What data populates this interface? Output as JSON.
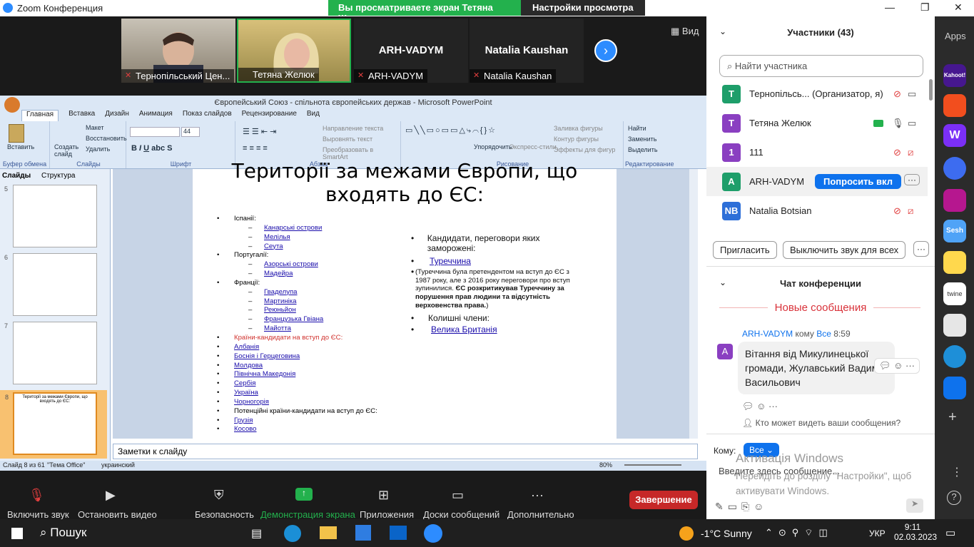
{
  "window": {
    "title": "Zoom Конференция"
  },
  "share_banner": {
    "text": "Вы просматриваете экран Тетяна Желюк",
    "settings": "Настройки просмотра"
  },
  "view_button": "Вид",
  "videos": [
    {
      "name": "Тернопільський Цен..."
    },
    {
      "name": "Тетяна Желюк"
    },
    {
      "name": "ARH-VADYM",
      "label": "ARH-VADYM"
    },
    {
      "name": "Natalia Kaushan",
      "label": "Natalia Kaushan"
    }
  ],
  "ppt": {
    "title": "Європейський Союз - спільнота європейських держав - Microsoft PowerPoint",
    "tabs": [
      "Главная",
      "Вставка",
      "Дизайн",
      "Анимация",
      "Показ слайдов",
      "Рецензирование",
      "Вид"
    ],
    "groups": {
      "clipboard": "Буфер обмена",
      "paste": "Вставить",
      "slides": "Слайды",
      "create_slide": "Создать слайд",
      "layout": "Макет",
      "reset": "Восстановить",
      "delete": "Удалить",
      "font": "Шрифт",
      "font_size": "44",
      "paragraph": "Абзац",
      "text_dir": "Направление текста",
      "align_text": "Выровнять текст",
      "smartart": "Преобразовать в SmartArt",
      "drawing": "Рисование",
      "arrange": "Упорядочить",
      "quick_styles": "Экспресс-стили",
      "fill": "Заливка фигуры",
      "outline": "Контур фигуры",
      "effects": "Эффекты для фигур",
      "editing": "Редактирование",
      "find": "Найти",
      "replace": "Заменить",
      "select": "Выделить"
    },
    "pane_tabs": {
      "slides": "Слайды",
      "outline": "Структура"
    },
    "thumbs": [
      {
        "n": "5"
      },
      {
        "n": "6"
      },
      {
        "n": "7"
      },
      {
        "n": "8",
        "title": "Території за межами Європи, що входять до ЄС:"
      }
    ],
    "slide": {
      "title_line1": "Території за межами Європи, що",
      "title_line2": "входять до ЄС:",
      "left": [
        {
          "t": "Іспанії:",
          "lvl": 0
        },
        {
          "t": "Канарські острови",
          "lvl": 1,
          "link": true
        },
        {
          "t": "Мелілья",
          "lvl": 1,
          "link": true
        },
        {
          "t": "Сеута",
          "lvl": 1,
          "link": true
        },
        {
          "t": "Португалії:",
          "lvl": 0
        },
        {
          "t": "Азорські острови",
          "lvl": 1,
          "link": true
        },
        {
          "t": "Мадейра",
          "lvl": 1,
          "link": true
        },
        {
          "t": "Франції:",
          "lvl": 0
        },
        {
          "t": "Гваделупа",
          "lvl": 1,
          "link": true
        },
        {
          "t": "Мартиніка",
          "lvl": 1,
          "link": true
        },
        {
          "t": "Реюньйон",
          "lvl": 1,
          "link": true
        },
        {
          "t": "Французька Гвіана",
          "lvl": 1,
          "link": true
        },
        {
          "t": "Майотта",
          "lvl": 1,
          "link": true
        },
        {
          "t": "Країни-кандидати на вступ до ЄС:",
          "lvl": 0,
          "red": true
        },
        {
          "t": "Албанія",
          "lvl": 0,
          "link": true
        },
        {
          "t": "Боснія і Герцеговина",
          "lvl": 0,
          "link": true
        },
        {
          "t": "Молдова",
          "lvl": 0,
          "link": true
        },
        {
          "t": "Північна Македонія",
          "lvl": 0,
          "link": true
        },
        {
          "t": "Сербія",
          "lvl": 0,
          "link": true
        },
        {
          "t": "Україна",
          "lvl": 0,
          "link": true
        },
        {
          "t": "Чорногорія",
          "lvl": 0,
          "link": true
        },
        {
          "t": "Потенційні країни-кандидати на вступ до ЄС:",
          "lvl": 0
        },
        {
          "t": "Грузія",
          "lvl": 0,
          "link": true
        },
        {
          "t": "Косово",
          "lvl": 0,
          "link": true
        }
      ],
      "right": {
        "candidates": "Кандидати, переговори яких заморожені:",
        "turkey": "Туреччина",
        "note": "(Туреччина була претендентом на вступ до ЄС з 1987 року, але з 2016 року переговори про вступ зупинилися.",
        "note_bold": "ЄС розкритикував Туреччину за порушення прав людини та відсутність верховенства права.",
        "note_end": ")",
        "former": "Колишні члени:",
        "uk": "Велика Британія"
      }
    },
    "notes": "Заметки к слайду",
    "status": {
      "slide": "Слайд 8 из 61",
      "theme": "\"Тема Office\"",
      "lang": "украинский",
      "zoom": "80%"
    }
  },
  "participants": {
    "header": "Участники (43)",
    "search_placeholder": "Найти участника",
    "list": [
      {
        "initial": "T",
        "name": "Тернопільсь... (Организатор, я)",
        "color": "#1e9e6a"
      },
      {
        "initial": "T",
        "name": "Тетяна Желюк",
        "color": "#8a3fc1"
      },
      {
        "initial": "1",
        "name": "111",
        "color": "#8a3fc1"
      },
      {
        "initial": "A",
        "name": "ARH-VADYM",
        "color": "#1e9e6a",
        "action": "Попросить вкл"
      },
      {
        "initial": "NB",
        "name": "Natalia Botsian",
        "color": "#2d6fd8"
      }
    ],
    "invite": "Пригласить",
    "mute_all": "Выключить звук для всех"
  },
  "chat": {
    "header": "Чат конференции",
    "new_messages": "Новые сообщения",
    "sender": "ARH-VADYM",
    "to_word": "кому",
    "to": "Все",
    "time": "8:59",
    "sender_initial": "A",
    "message": "Вітання від Микулинецької громади, Жулавський Вадим Васильович",
    "who_can_see": "Кто может видеть ваши сообщения?",
    "to_label": "Кому:",
    "to_select": "Все",
    "input_placeholder": "Введите здесь сообщение...",
    "activation_title": "Активація Windows",
    "activation_text": "Перейдіть до розділу \"Настройки\", щоб активувати Windows."
  },
  "apps_label": "Apps",
  "toolbar": {
    "audio": "Включить звук",
    "video": "Остановить видео",
    "security": "Безопасность",
    "share": "Демонстрация экрана",
    "apps": "Приложения",
    "boards": "Доски сообщений",
    "more": "Дополнительно",
    "end": "Завершение"
  },
  "taskbar": {
    "search": "Пошук",
    "weather": "-1°C  Sunny",
    "lang": "УКР",
    "time": "9:11",
    "date": "02.03.2023"
  }
}
